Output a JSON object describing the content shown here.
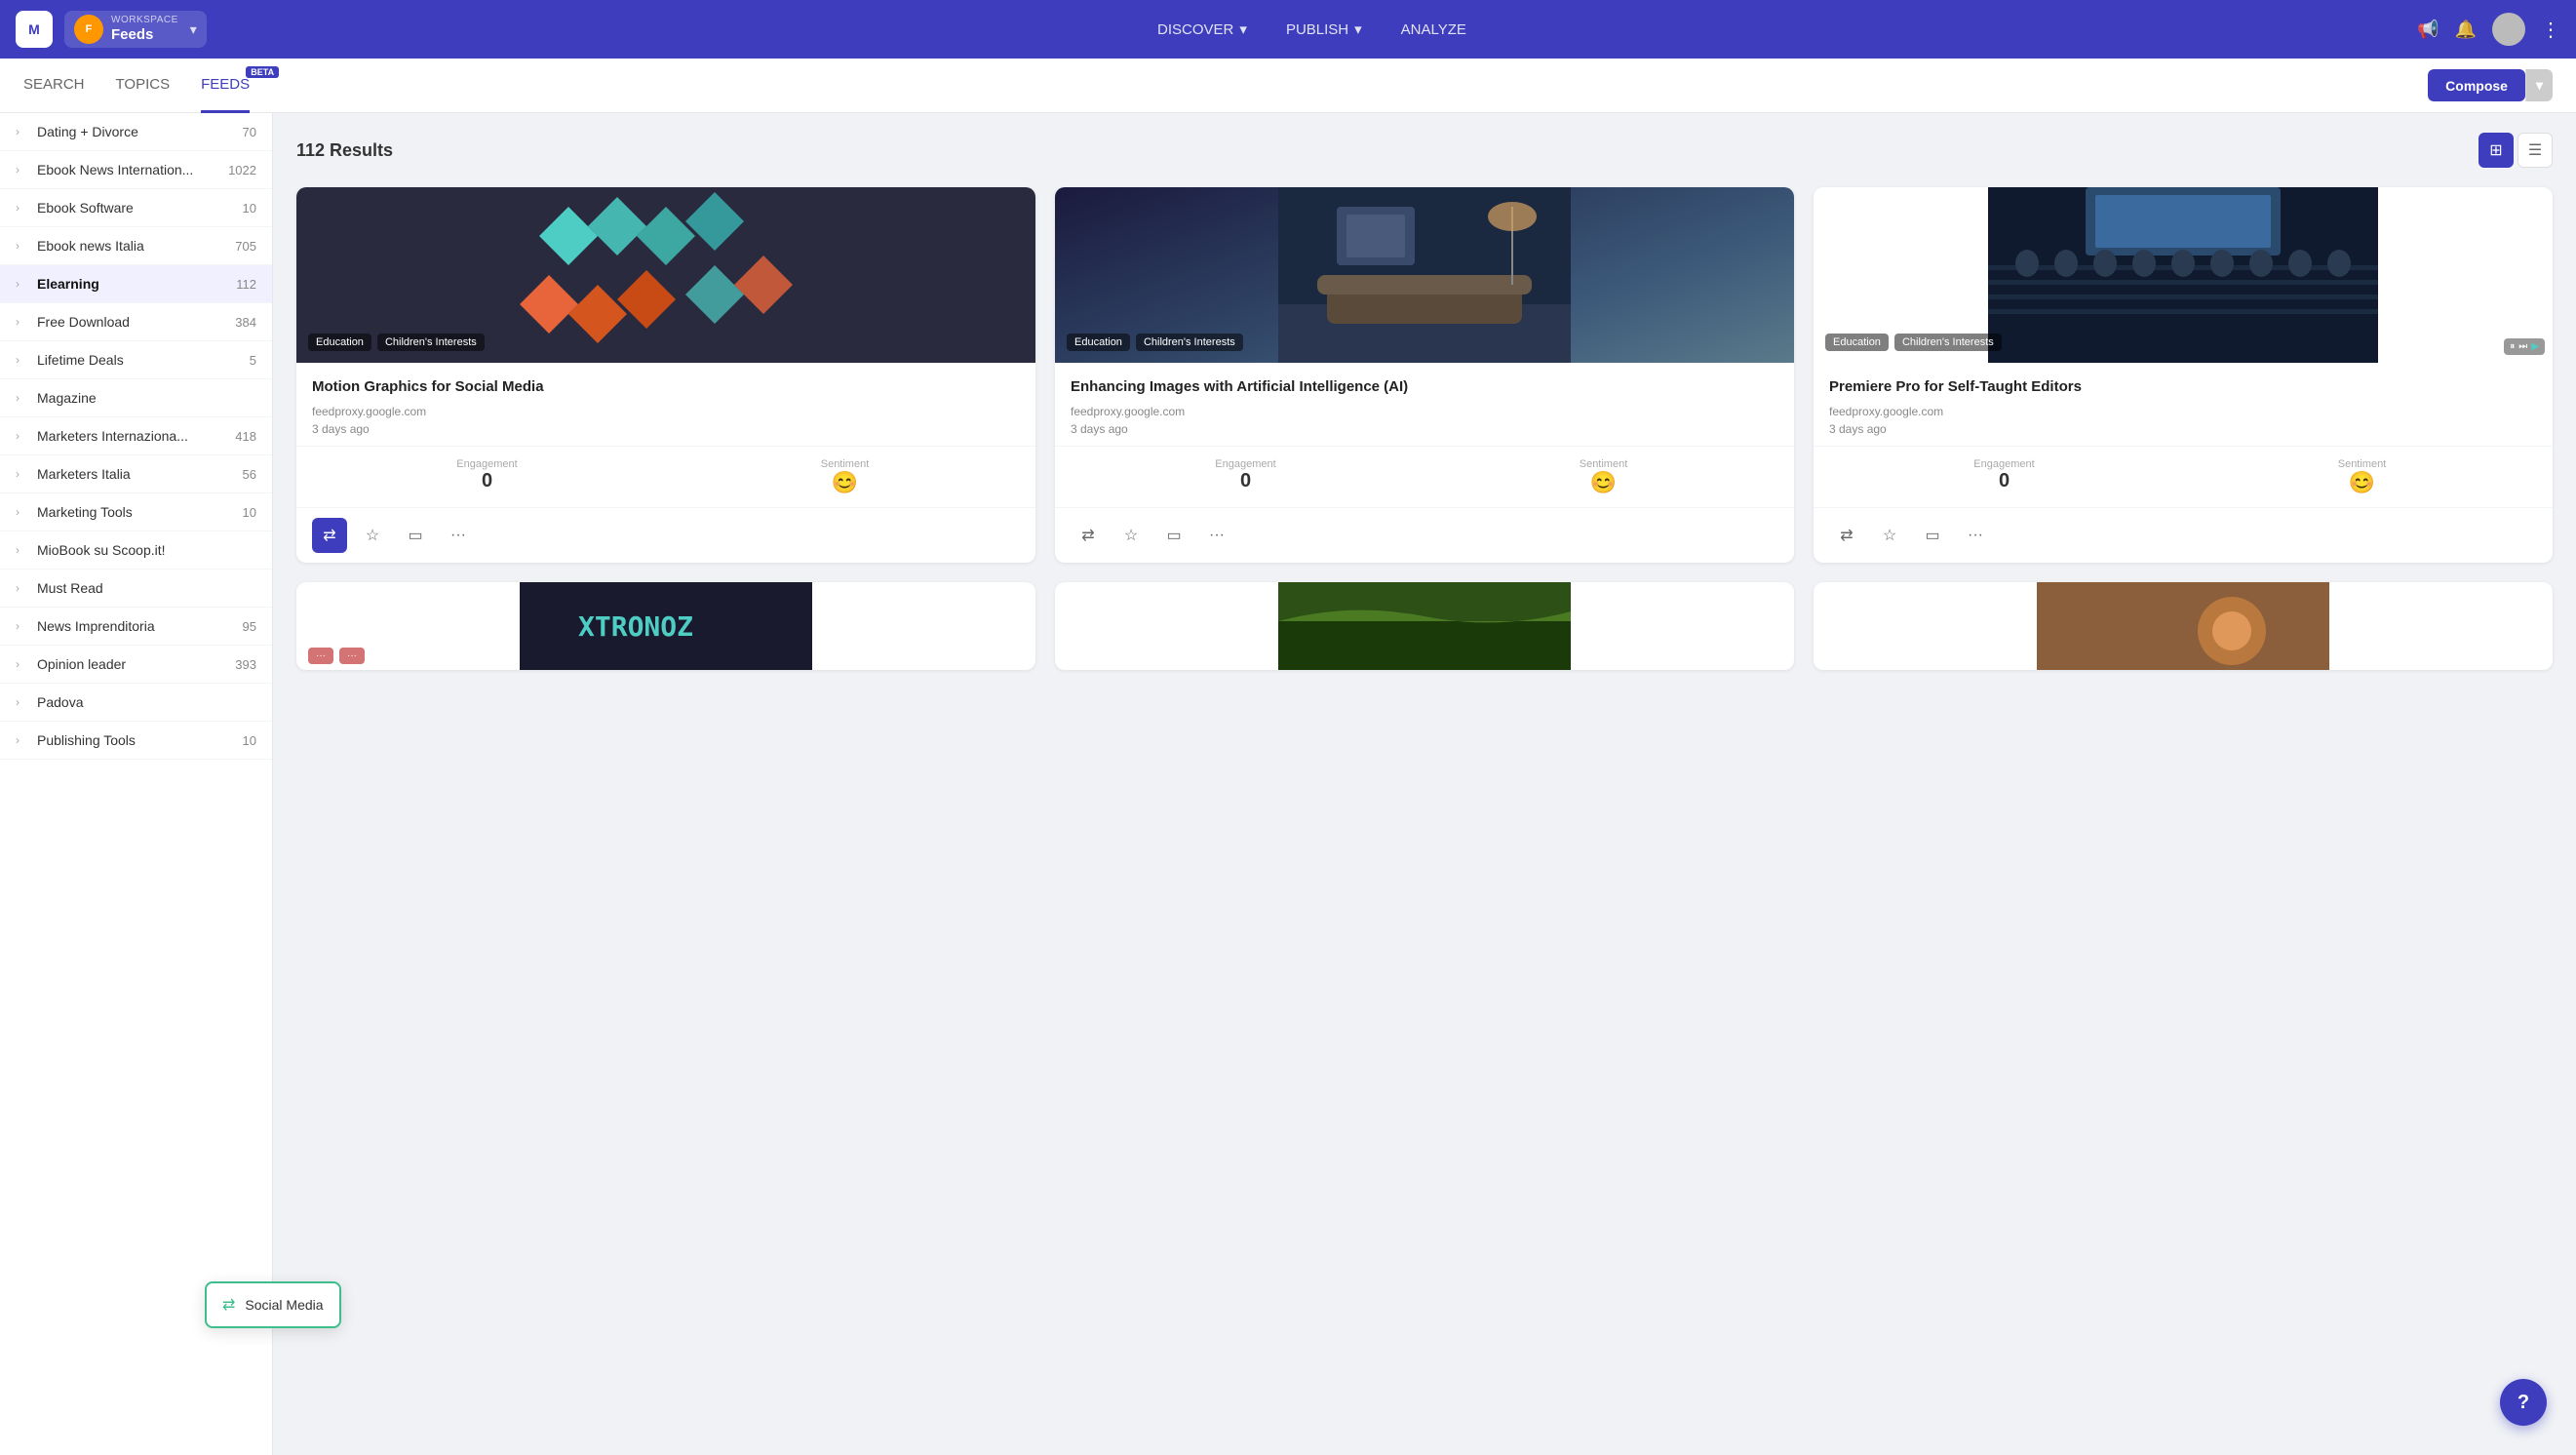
{
  "nav": {
    "logo_text": "M",
    "workspace_label": "WORKSPACE",
    "feeds_label": "Feeds",
    "feeds_icon": "F",
    "discover_label": "DISCOVER",
    "publish_label": "PUBLISH",
    "analyze_label": "ANALYZE"
  },
  "subnav": {
    "search_label": "SEARCH",
    "topics_label": "TOPICS",
    "feeds_label": "FEEDS",
    "beta_label": "BETA",
    "compose_label": "Compose"
  },
  "results": {
    "count": "112 Results",
    "count_num": 112
  },
  "sidebar": {
    "items": [
      {
        "label": "Dating + Divorce",
        "count": "70",
        "active": false
      },
      {
        "label": "Ebook News Internation...",
        "count": "1022",
        "active": false
      },
      {
        "label": "Ebook Software",
        "count": "10",
        "active": false
      },
      {
        "label": "Ebook news Italia",
        "count": "705",
        "active": false
      },
      {
        "label": "Elearning",
        "count": "112",
        "active": true
      },
      {
        "label": "Free Download",
        "count": "384",
        "active": false
      },
      {
        "label": "Lifetime Deals",
        "count": "5",
        "active": false
      },
      {
        "label": "Magazine",
        "count": "",
        "active": false
      },
      {
        "label": "Marketers Internaziona...",
        "count": "418",
        "active": false
      },
      {
        "label": "Marketers Italia",
        "count": "56",
        "active": false
      },
      {
        "label": "Marketing Tools",
        "count": "10",
        "active": false
      },
      {
        "label": "MioBook su Scoop.it!",
        "count": "",
        "active": false
      },
      {
        "label": "Must Read",
        "count": "",
        "active": false
      },
      {
        "label": "News Imprenditoria",
        "count": "95",
        "active": false
      },
      {
        "label": "Opinion leader",
        "count": "393",
        "active": false
      },
      {
        "label": "Padova",
        "count": "",
        "active": false
      },
      {
        "label": "Publishing Tools",
        "count": "10",
        "active": false
      }
    ]
  },
  "cards": [
    {
      "title": "Motion Graphics for Social Media",
      "source": "feedproxy.google.com",
      "time": "3 days ago",
      "tags": [
        "Education",
        "Children's Interests"
      ],
      "engagement": "0",
      "sentiment": "😊",
      "has_video": false,
      "bg_type": "geo"
    },
    {
      "title": "Enhancing Images with Artificial Intelligence (AI)",
      "source": "feedproxy.google.com",
      "time": "3 days ago",
      "tags": [
        "Education",
        "Children's Interests"
      ],
      "engagement": "0",
      "sentiment": "😊",
      "has_video": false,
      "bg_type": "interior"
    },
    {
      "title": "Premiere Pro for Self-Taught Editors",
      "source": "feedproxy.google.com",
      "time": "3 days ago",
      "tags": [
        "Education",
        "Children's Interests"
      ],
      "engagement": "0",
      "sentiment": "😊",
      "has_video": true,
      "bg_type": "conference"
    }
  ],
  "labels": {
    "engagement": "Engagement",
    "sentiment": "Sentiment",
    "social_media_tooltip": "Social Media"
  }
}
